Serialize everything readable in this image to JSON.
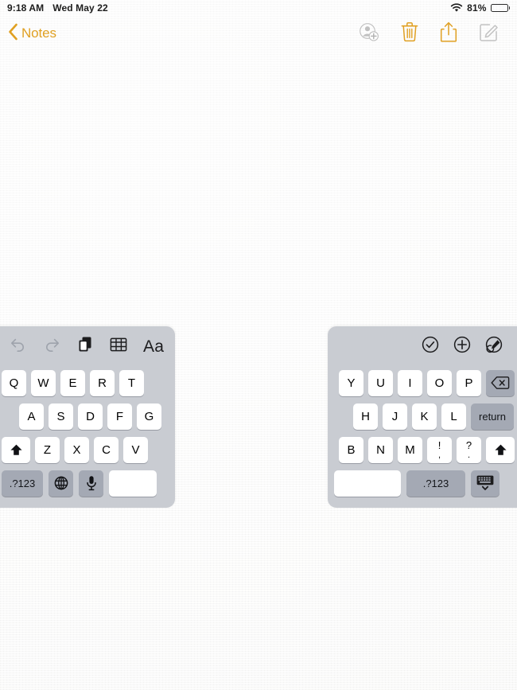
{
  "status_bar": {
    "time": "9:18 AM",
    "date": "Wed May 22",
    "battery_percent": "81%",
    "wifi_icon": "wifi-icon",
    "battery_icon": "battery-icon"
  },
  "nav_bar": {
    "back_label": "Notes",
    "back_chevron_icon": "chevron-left-icon",
    "actions": [
      {
        "name": "add-person-button",
        "icon": "person-add-icon",
        "color": "#b9b9b9",
        "enabled": false
      },
      {
        "name": "delete-button",
        "icon": "trash-icon",
        "color": "#e0a022",
        "enabled": true
      },
      {
        "name": "share-button",
        "icon": "share-icon",
        "color": "#e0a022",
        "enabled": true
      },
      {
        "name": "compose-button",
        "icon": "compose-icon",
        "color": "#c2c2c2",
        "enabled": false
      }
    ]
  },
  "colors": {
    "accent": "#e0a022",
    "keyboard_bg": "#c9ccd2",
    "key_bg": "#ffffff",
    "key_dark_bg": "#a4a9b4",
    "paper_bg": "#f7f7f6"
  },
  "keyboard": {
    "split": true,
    "left": {
      "toolbar": [
        {
          "name": "undo-button",
          "icon": "undo-icon",
          "label": "",
          "enabled": false
        },
        {
          "name": "redo-button",
          "icon": "redo-icon",
          "label": "",
          "enabled": false
        },
        {
          "name": "paste-button",
          "icon": "copy-paste-icon",
          "label": "",
          "enabled": true
        },
        {
          "name": "table-button",
          "icon": "table-icon",
          "label": "",
          "enabled": true
        },
        {
          "name": "format-button",
          "icon": "format-text-icon",
          "label": "Aa",
          "enabled": true
        }
      ],
      "rows": [
        [
          {
            "label": "Q",
            "name": "key-q",
            "style": "light"
          },
          {
            "label": "W",
            "name": "key-w",
            "style": "light"
          },
          {
            "label": "E",
            "name": "key-e",
            "style": "light"
          },
          {
            "label": "R",
            "name": "key-r",
            "style": "light"
          },
          {
            "label": "T",
            "name": "key-t",
            "style": "light"
          }
        ],
        [
          {
            "label": "A",
            "name": "key-a",
            "style": "light"
          },
          {
            "label": "S",
            "name": "key-s",
            "style": "light"
          },
          {
            "label": "D",
            "name": "key-d",
            "style": "light"
          },
          {
            "label": "F",
            "name": "key-f",
            "style": "light"
          },
          {
            "label": "G",
            "name": "key-g",
            "style": "light"
          }
        ],
        [
          {
            "label": "",
            "name": "key-shift-left",
            "style": "light",
            "icon": "shift-arrow-icon"
          },
          {
            "label": "Z",
            "name": "key-z",
            "style": "light"
          },
          {
            "label": "X",
            "name": "key-x",
            "style": "light"
          },
          {
            "label": "C",
            "name": "key-c",
            "style": "light"
          },
          {
            "label": "V",
            "name": "key-v",
            "style": "light"
          }
        ],
        [
          {
            "label": ".?123",
            "name": "key-numbers-left",
            "style": "dark"
          },
          {
            "label": "",
            "name": "key-globe",
            "style": "dark",
            "icon": "globe-icon"
          },
          {
            "label": "",
            "name": "key-dictation",
            "style": "dark",
            "icon": "microphone-icon"
          },
          {
            "label": "",
            "name": "key-space-left",
            "style": "light"
          }
        ]
      ]
    },
    "right": {
      "toolbar": [
        {
          "name": "checklist-button",
          "icon": "checkmark-circle-icon",
          "enabled": true
        },
        {
          "name": "attach-button",
          "icon": "plus-circle-icon",
          "enabled": true
        },
        {
          "name": "markup-button",
          "icon": "markup-pen-circle-icon",
          "enabled": true
        }
      ],
      "rows": [
        [
          {
            "label": "Y",
            "name": "key-y",
            "style": "light"
          },
          {
            "label": "U",
            "name": "key-u",
            "style": "light"
          },
          {
            "label": "I",
            "name": "key-i",
            "style": "light"
          },
          {
            "label": "O",
            "name": "key-o",
            "style": "light"
          },
          {
            "label": "P",
            "name": "key-p",
            "style": "light"
          },
          {
            "label": "",
            "name": "key-delete",
            "style": "dark",
            "icon": "backspace-icon"
          }
        ],
        [
          {
            "label": "H",
            "name": "key-h",
            "style": "light"
          },
          {
            "label": "J",
            "name": "key-j",
            "style": "light"
          },
          {
            "label": "K",
            "name": "key-k",
            "style": "light"
          },
          {
            "label": "L",
            "name": "key-l",
            "style": "light"
          },
          {
            "label": "return",
            "name": "key-return",
            "style": "dark"
          }
        ],
        [
          {
            "label": "B",
            "name": "key-b",
            "style": "light"
          },
          {
            "label": "N",
            "name": "key-n",
            "style": "light"
          },
          {
            "label": "M",
            "name": "key-m",
            "style": "light"
          },
          {
            "label": "",
            "name": "key-exclaim-comma",
            "style": "light",
            "top": "!",
            "bottom": ","
          },
          {
            "label": "",
            "name": "key-question-period",
            "style": "light",
            "top": "?",
            "bottom": "."
          },
          {
            "label": "",
            "name": "key-shift-right",
            "style": "light",
            "icon": "shift-arrow-icon"
          }
        ],
        [
          {
            "label": "",
            "name": "key-space-right",
            "style": "light"
          },
          {
            "label": ".?123",
            "name": "key-numbers-right",
            "style": "dark"
          },
          {
            "label": "",
            "name": "key-hide-keyboard",
            "style": "dark",
            "icon": "hide-keyboard-icon"
          }
        ]
      ]
    }
  }
}
